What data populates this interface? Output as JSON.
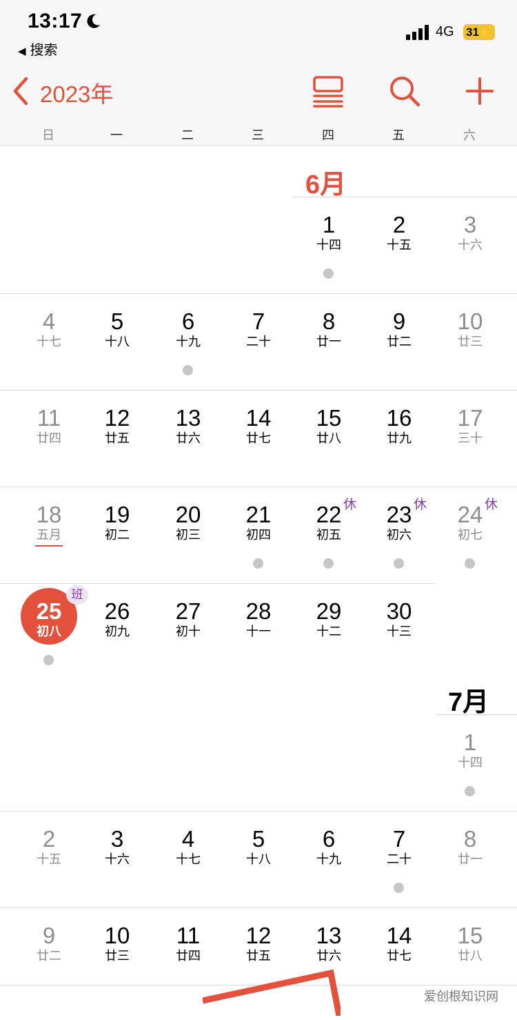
{
  "status_bar": {
    "time": "13:17",
    "back_app": "搜索",
    "network": "4G",
    "battery": "31"
  },
  "nav": {
    "year": "2023年"
  },
  "weekdays": [
    "日",
    "一",
    "二",
    "三",
    "四",
    "五",
    "六"
  ],
  "months": [
    {
      "label": "6月",
      "weeks": [
        [
          null,
          null,
          null,
          null,
          {
            "d": "1",
            "l": "十四",
            "dot": true
          },
          {
            "d": "2",
            "l": "十五"
          },
          {
            "d": "3",
            "l": "十六"
          }
        ],
        [
          {
            "d": "4",
            "l": "十七"
          },
          {
            "d": "5",
            "l": "十八"
          },
          {
            "d": "6",
            "l": "十九",
            "dot": true
          },
          {
            "d": "7",
            "l": "二十"
          },
          {
            "d": "8",
            "l": "廿一"
          },
          {
            "d": "9",
            "l": "廿二"
          },
          {
            "d": "10",
            "l": "廿三"
          }
        ],
        [
          {
            "d": "11",
            "l": "廿四"
          },
          {
            "d": "12",
            "l": "廿五"
          },
          {
            "d": "13",
            "l": "廿六"
          },
          {
            "d": "14",
            "l": "廿七"
          },
          {
            "d": "15",
            "l": "廿八"
          },
          {
            "d": "16",
            "l": "廿九"
          },
          {
            "d": "17",
            "l": "三十"
          }
        ],
        [
          {
            "d": "18",
            "l": "五月",
            "under": true
          },
          {
            "d": "19",
            "l": "初二"
          },
          {
            "d": "20",
            "l": "初三"
          },
          {
            "d": "21",
            "l": "初四",
            "dot": true
          },
          {
            "d": "22",
            "l": "初五",
            "dot": true,
            "badge": "休"
          },
          {
            "d": "23",
            "l": "初六",
            "dot": true,
            "badge": "休"
          },
          {
            "d": "24",
            "l": "初七",
            "dot": true,
            "badge": "休"
          }
        ],
        [
          {
            "d": "25",
            "l": "初八",
            "dot": true,
            "today": true,
            "badge": "班"
          },
          {
            "d": "26",
            "l": "初九"
          },
          {
            "d": "27",
            "l": "初十"
          },
          {
            "d": "28",
            "l": "十一"
          },
          {
            "d": "29",
            "l": "十二"
          },
          {
            "d": "30",
            "l": "十三"
          },
          null
        ]
      ]
    },
    {
      "label": "7月",
      "weeks": [
        [
          null,
          null,
          null,
          null,
          null,
          null,
          {
            "d": "1",
            "l": "十四",
            "dot": true
          }
        ],
        [
          {
            "d": "2",
            "l": "十五"
          },
          {
            "d": "3",
            "l": "十六"
          },
          {
            "d": "4",
            "l": "十七"
          },
          {
            "d": "5",
            "l": "十八"
          },
          {
            "d": "6",
            "l": "十九"
          },
          {
            "d": "7",
            "l": "二十",
            "dot": true
          },
          {
            "d": "8",
            "l": "廿一"
          }
        ],
        [
          {
            "d": "9",
            "l": "廿二"
          },
          {
            "d": "10",
            "l": "廿三"
          },
          {
            "d": "11",
            "l": "廿四"
          },
          {
            "d": "12",
            "l": "廿五"
          },
          {
            "d": "13",
            "l": "廿六"
          },
          {
            "d": "14",
            "l": "廿七"
          },
          {
            "d": "15",
            "l": "廿八"
          }
        ]
      ]
    }
  ],
  "colors": {
    "accent": "#e3503c",
    "holiday": "#8a3fa8",
    "dot": "#c6c6c6",
    "weekend": "#8d8d8d"
  },
  "watermark": "爱创根知识网"
}
